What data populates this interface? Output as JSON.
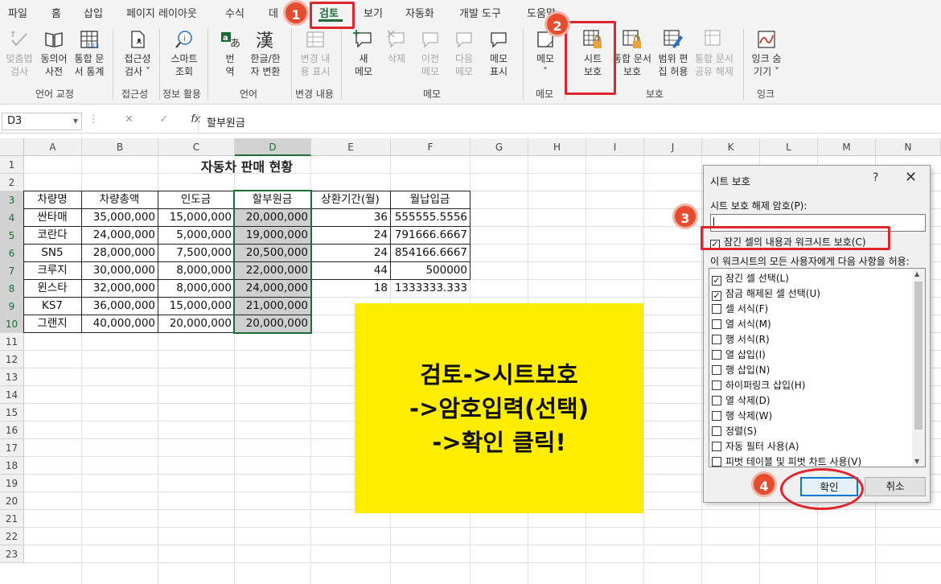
{
  "menu": {
    "tabs": [
      "파일",
      "홈",
      "삽입",
      "페이지 레이아웃",
      "수식",
      "데",
      "검토",
      "보기",
      "자동화",
      "개발 도구",
      "도움말"
    ],
    "active_tab": "검토"
  },
  "ribbon": {
    "spell_1": "맞춤법",
    "spell_2": "검사",
    "thes_1": "동의어",
    "thes_2": "사전",
    "stats_1": "통합 문",
    "stats_2": "서 통계",
    "acc_1": "접근성",
    "acc_2": "검사 ˅",
    "smart_1": "스마트",
    "smart_2": "조회",
    "trans_1": "번",
    "trans_2": "역",
    "hanja_1": "한글/한",
    "hanja_2": "자 변환",
    "track_1": "변경 내",
    "track_2": "용 표시",
    "newc_1": "새",
    "newc_2": "메모",
    "delc": "삭제",
    "prevc_1": "이전",
    "prevc_2": "메모",
    "nextc_1": "다음",
    "nextc_2": "메모",
    "showc_1": "메모",
    "showc_2": "표시",
    "notes_1": "메모",
    "notes_2": "˅",
    "psheet_1": "시트",
    "psheet_2": "보호",
    "pwb_1": "통합 문서",
    "pwb_2": "보호",
    "allow_1": "범위 편",
    "allow_2": "집 허용",
    "unshare_1": "통합 문서",
    "unshare_2": "공유 해제",
    "ink_1": "잉크 숨",
    "ink_2": "기기 ˅",
    "groups": {
      "proofing": "언어 교정",
      "accessibility": "접근성",
      "insights": "정보 활용",
      "language": "언어",
      "changes": "변경 내용",
      "comments": "메모",
      "notes": "메모",
      "protect": "보호",
      "ink": "잉크"
    }
  },
  "formula_bar": {
    "cell_ref": "D3",
    "cancel": "✕",
    "enter": "✓",
    "fx": "fx",
    "content": "할부원금"
  },
  "sheet": {
    "columns": [
      "A",
      "B",
      "C",
      "D",
      "E",
      "F",
      "G",
      "H",
      "I",
      "J",
      "K",
      "L",
      "M",
      "N"
    ],
    "rows": [
      "1",
      "2",
      "3",
      "4",
      "5",
      "6",
      "7",
      "8",
      "9",
      "10",
      "11",
      "12",
      "13",
      "14",
      "15",
      "16",
      "17",
      "18",
      "19",
      "20",
      "21",
      "22",
      "23"
    ],
    "title": "자동차 판매 현황",
    "headers": [
      "차량명",
      "차량총액",
      "인도금",
      "할부원금",
      "상환기간(월)",
      "월납입금"
    ],
    "data": [
      [
        "싼타매",
        "35,000,000",
        "15,000,000",
        "20,000,000",
        "36",
        "555555.5556"
      ],
      [
        "코란다",
        "24,000,000",
        "5,000,000",
        "19,000,000",
        "24",
        "791666.6667"
      ],
      [
        "SN5",
        "28,000,000",
        "7,500,000",
        "20,500,000",
        "24",
        "854166.6667"
      ],
      [
        "크루지",
        "30,000,000",
        "8,000,000",
        "22,000,000",
        "44",
        "500000"
      ],
      [
        "윈스타",
        "32,000,000",
        "8,000,000",
        "24,000,000",
        "18",
        "1333333.333"
      ],
      [
        "KS7",
        "36,000,000",
        "15,000,000",
        "21,000,000",
        "",
        ""
      ],
      [
        "그랜지",
        "40,000,000",
        "20,000,000",
        "20,000,000",
        "",
        ""
      ]
    ]
  },
  "sticky_note": {
    "line1": "검토->시트보호",
    "line2": "->암호입력(선택)",
    "line3": "->확인 클릭!"
  },
  "dialog": {
    "title": "시트 보호",
    "help": "?",
    "close": "✕",
    "password_label": "시트 보호 해제 암호(P):",
    "password_value": "",
    "protect_check_label": "잠긴 셀의 내용과 워크시트 보호(C)",
    "protect_checked": true,
    "allow_label": "이 워크시트의 모든 사용자에게 다음 사항을 허용:",
    "options": [
      {
        "label": "잠긴 셀 선택(L)",
        "checked": "✓"
      },
      {
        "label": "잠금 해제된 셀 선택(U)",
        "checked": "✓"
      },
      {
        "label": "셀 서식(F)",
        "checked": ""
      },
      {
        "label": "열 서식(M)",
        "checked": ""
      },
      {
        "label": "행 서식(R)",
        "checked": ""
      },
      {
        "label": "열 삽입(I)",
        "checked": ""
      },
      {
        "label": "행 삽입(N)",
        "checked": ""
      },
      {
        "label": "하이퍼링크 삽입(H)",
        "checked": ""
      },
      {
        "label": "열 삭제(D)",
        "checked": ""
      },
      {
        "label": "행 삭제(W)",
        "checked": ""
      },
      {
        "label": "정렬(S)",
        "checked": ""
      },
      {
        "label": "자동 필터 사용(A)",
        "checked": ""
      },
      {
        "label": "피벗 테이블 및 피벗 차트 사용(V)",
        "checked": ""
      }
    ],
    "ok": "확인",
    "cancel": "취소"
  },
  "callouts": {
    "step1": "1",
    "step2": "2",
    "step3": "3",
    "step4": "4"
  },
  "colors": {
    "accent_green": "#1e6b3a",
    "callout_red": "#e0242b",
    "sticky_yellow": "#ffed00",
    "badge_orange": "#e44d2e"
  }
}
